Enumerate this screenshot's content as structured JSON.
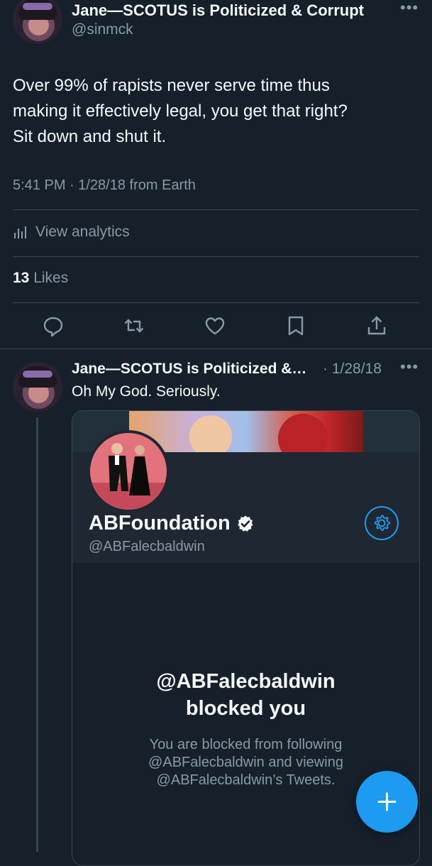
{
  "main_tweet": {
    "display_name": "Jane—SCOTUS is Politicized & Corrupt",
    "handle": "@sinmck",
    "text_lines": [
      "Over 99% of rapists never serve time thus",
      "making it effectively legal, you get that right?",
      "Sit down and shut it."
    ],
    "timestamp": "5:41 PM · 1/28/18 from Earth",
    "analytics_label": "View analytics",
    "likes_count": "13",
    "likes_label": "Likes",
    "more_icon": "more-horizontal-icon"
  },
  "actions": [
    "reply-icon",
    "retweet-icon",
    "like-icon",
    "bookmark-icon",
    "share-icon"
  ],
  "reply_tweet": {
    "display_name": "Jane—SCOTUS is Politicized &…",
    "date": "· 1/28/18",
    "text": "Oh My God. Seriously.",
    "embedded_profile": {
      "name": "ABFoundation",
      "handle": "@ABFalecbaldwin",
      "blocked_title_line1": "@ABFalecbaldwin",
      "blocked_title_line2": "blocked you",
      "blocked_sub_lines": [
        "You are blocked from following",
        "@ABFalecbaldwin and viewing",
        "@ABFalecbaldwin’s Tweets."
      ]
    }
  },
  "fab_icon": "compose-plus-icon",
  "colors": {
    "background": "#15202b",
    "accent": "#1d9bf0",
    "muted": "#8b98a5",
    "divider": "#38444d"
  }
}
